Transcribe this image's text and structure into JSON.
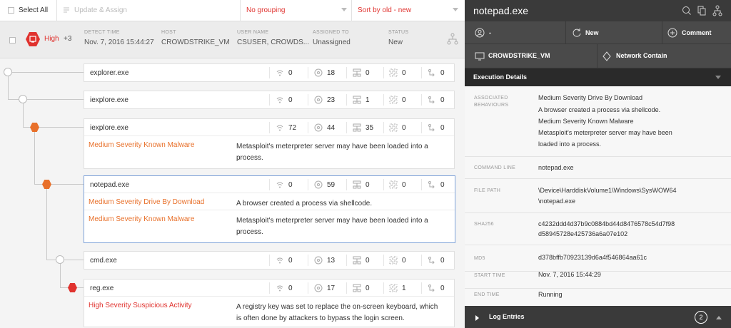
{
  "toolbar": {
    "select_all": "Select All",
    "update_assign": "Update & Assign",
    "grouping": "No grouping",
    "sort": "Sort by old - new"
  },
  "detection": {
    "severity": "High",
    "extra_count": "+3",
    "detect_time_label": "DETECT TIME",
    "detect_time": "Nov. 7, 2016 15:44:27",
    "host_label": "HOST",
    "host": "CROWDSTRIKE_VM",
    "user_label": "USER NAME",
    "user": "CSUSER, CROWDS...",
    "assigned_label": "ASSIGNED TO",
    "assigned": "Unassigned",
    "status_label": "STATUS",
    "status": "New"
  },
  "processes": [
    {
      "name": "explorer.exe",
      "stats": [
        "0",
        "18",
        "0",
        "0",
        "0"
      ]
    },
    {
      "name": "iexplore.exe",
      "stats": [
        "0",
        "23",
        "1",
        "0",
        "0"
      ]
    },
    {
      "name": "iexplore.exe",
      "stats": [
        "72",
        "44",
        "35",
        "0",
        "0"
      ],
      "behaviors": [
        {
          "name": "Medium Severity Known Malware",
          "desc": "Metasploit's meterpreter server may have been loaded into a process."
        }
      ]
    },
    {
      "name": "notepad.exe",
      "stats": [
        "0",
        "59",
        "0",
        "0",
        "0"
      ],
      "behaviors": [
        {
          "name": "Medium Severity Drive By Download",
          "desc": "A browser created a process via shellcode."
        },
        {
          "name": "Medium Severity Known Malware",
          "desc": "Metasploit's meterpreter server may have been loaded into a process."
        }
      ]
    },
    {
      "name": "cmd.exe",
      "stats": [
        "0",
        "13",
        "0",
        "0",
        "0"
      ]
    },
    {
      "name": "reg.exe",
      "stats": [
        "0",
        "17",
        "0",
        "1",
        "0"
      ],
      "behaviors": [
        {
          "name": "High Severity Suspicious Activity",
          "desc": "A registry key was set to replace the on-screen keyboard, which is often done by attackers to bypass the login screen."
        }
      ]
    }
  ],
  "panel": {
    "title": "notepad.exe",
    "assignee": "-",
    "status_btn": "New",
    "comment_btn": "Comment",
    "host_btn": "CROWDSTRIKE_VM",
    "contain_btn": "Network Contain",
    "section": "Execution Details",
    "assoc_label": "ASSOCIATED BEHAVIOURS",
    "assoc": [
      {
        "name": "Medium Severity Drive By Download",
        "desc": "A browser created a process via shellcode."
      },
      {
        "name": "Medium Severity Known Malware",
        "desc": "Metasploit's meterpreter server may have been loaded into a process."
      }
    ],
    "cmd_label": "COMMAND LINE",
    "cmd": "notepad.exe",
    "path_label": "FILE PATH",
    "path_1": "\\Device\\HarddiskVolume1\\Windows\\SysWOW64",
    "path_2": "\\notepad.exe",
    "sha_label": "SHA256",
    "sha_1": "c4232ddd4d37b9c0884bd44d8476578c54d7f98",
    "sha_2": "d58945728e425736a6a07e102",
    "md5_label": "MD5",
    "md5": "d378bffb70923139d6a4f546864aa61c",
    "start_label": "START TIME",
    "start": "Nov. 7, 2016 15:44:29",
    "end_label": "END TIME",
    "end": "Running",
    "log_label": "Log Entries",
    "log_count": "2"
  },
  "colors": {
    "high": "#e0322e",
    "medium": "#e8702a",
    "selected": "#7ea2d8"
  },
  "icons": [
    "network-icon",
    "disk-icon",
    "registry-icon",
    "module-icon",
    "child-process-icon",
    "crosshair-icon",
    "copy-icon",
    "tree-icon",
    "user-icon",
    "refresh-icon",
    "plus-circle-icon",
    "monitor-icon",
    "contain-icon",
    "chevron-down-icon"
  ]
}
